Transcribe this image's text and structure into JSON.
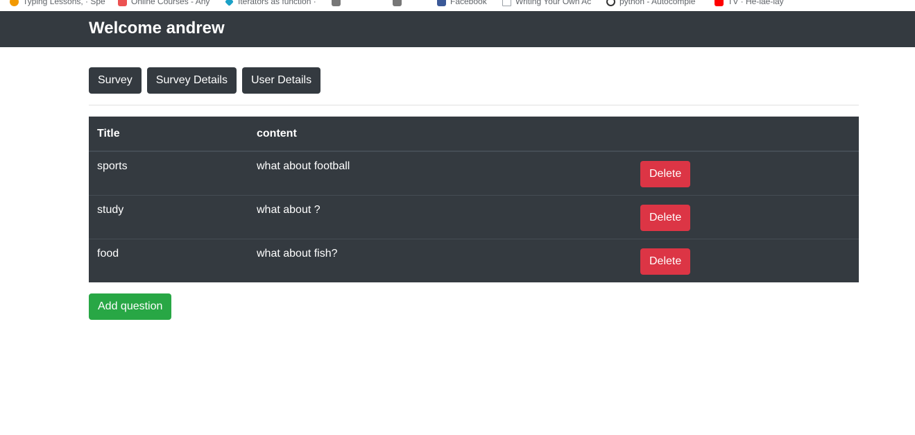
{
  "bookmarks": [
    {
      "label": "Typing Lessons, · Spe",
      "icon": "typing-club-icon",
      "color": "#f29900"
    },
    {
      "label": "Online Courses - Any",
      "icon": "udemy-icon",
      "color": "#ec5252"
    },
    {
      "label": "Iterators as function ·",
      "icon": "diamond-icon",
      "color": "#1ba1c7"
    },
    {
      "label": "",
      "icon": "arabic-site-icon",
      "color": "#777777"
    },
    {
      "label": "",
      "icon": "arabic-site-icon-2",
      "color": "#777777"
    },
    {
      "label": "Facebook",
      "icon": "facebook-icon",
      "color": "#3b5998"
    },
    {
      "label": "Writing Your Own Ac",
      "icon": "page-icon",
      "color": "#9aa0a6"
    },
    {
      "label": "python - Autocomple",
      "icon": "stackoverflow-icon",
      "color": "#333333"
    },
    {
      "label": "TV · He-lae-lay",
      "icon": "youtube-icon",
      "color": "#ff0000"
    }
  ],
  "navbar": {
    "brand": "Welcome andrew"
  },
  "nav_buttons": {
    "survey": "Survey",
    "survey_details": "Survey Details",
    "user_details": "User Details"
  },
  "table": {
    "headers": {
      "title": "Title",
      "content": "content",
      "action": ""
    },
    "rows": [
      {
        "title": "sports",
        "content": "what about football",
        "action": "Delete"
      },
      {
        "title": "study",
        "content": "what about ?",
        "action": "Delete"
      },
      {
        "title": "food",
        "content": "what about fish?",
        "action": "Delete"
      }
    ]
  },
  "add_button": "Add question",
  "colors": {
    "dark": "#343a40",
    "danger": "#dc3545",
    "success": "#28a745"
  }
}
